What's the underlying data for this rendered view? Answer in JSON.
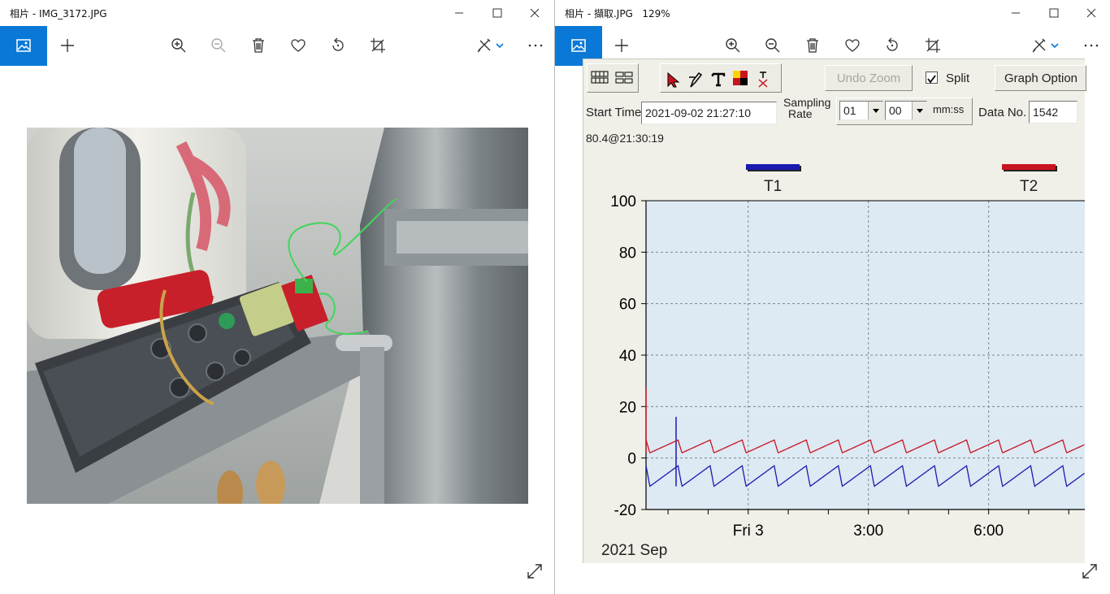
{
  "left_window": {
    "title": "相片 - IMG_3172.JPG",
    "photo_description_icons": [
      "picture-icon",
      "add-icon",
      "zoom-in-icon",
      "zoom-out-icon",
      "delete-icon",
      "favorite-icon",
      "rotate-icon",
      "crop-icon",
      "edit-icon",
      "more-icon"
    ]
  },
  "right_window": {
    "title": "相片 - 擷取.JPG",
    "zoom": "129%"
  },
  "graph_app": {
    "undo_zoom": "Undo Zoom",
    "split_label": "Split",
    "graph_option": "Graph Option",
    "start_time_label": "Start Time",
    "start_time_value": "2021-09-02 21:27:10",
    "sampling_rate_label_1": "Sampling",
    "sampling_rate_label_2": "Rate",
    "rate_min": "01",
    "rate_sec": "00",
    "rate_unit": "mm:ss",
    "data_no_label": "Data No.",
    "data_no_value": "1542",
    "readout": "80.4@21:30:19",
    "legend_t1": "T1",
    "legend_t2": "T2",
    "year_label": "2021 Sep",
    "colors": {
      "t1": "#1a1ab0",
      "t2": "#c8141e",
      "plot_bg": "#dde9f3"
    }
  },
  "chart_data": {
    "type": "line",
    "ylim": [
      -20,
      100
    ],
    "yticks": [
      "100",
      "80",
      "60",
      "40",
      "20",
      "0",
      "-20"
    ],
    "xticks": [
      "Fri 3",
      "3:00",
      "6:00"
    ],
    "xlim_hours": [
      21.45,
      32.4
    ],
    "xtick_hours": [
      24,
      27,
      30
    ],
    "grid": true,
    "legend": "top",
    "series": [
      {
        "name": "T1",
        "cycle_hours": 0.8,
        "low": -11,
        "high": -3,
        "start_hour": 21.45,
        "spike_hour": 22.2,
        "spike_value": 16
      },
      {
        "name": "T2",
        "cycle_hours": 0.8,
        "low": 2,
        "high": 7,
        "start_hour": 21.45,
        "spike_hour": 21.45,
        "spike_value": 27
      }
    ]
  }
}
